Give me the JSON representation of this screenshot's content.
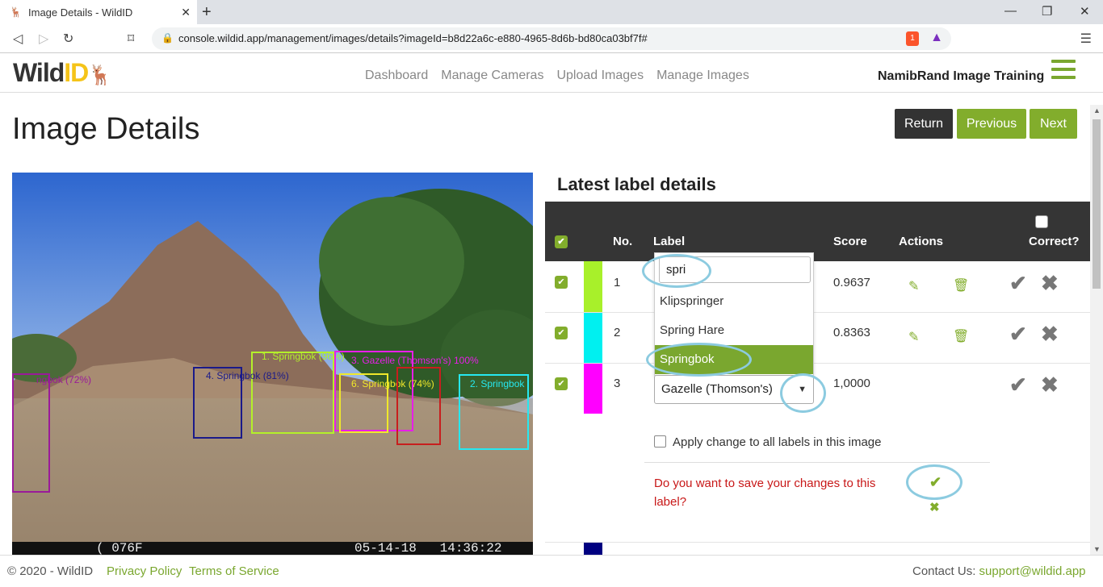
{
  "browser": {
    "tab_title": "Image Details - WildID",
    "url": "console.wildid.app/management/images/details?imageId=b8d22a6c-e880-4965-8d6b-bd80ca03bf7f#",
    "brave_badge": "1"
  },
  "header": {
    "logo_wild": "Wild",
    "logo_id": "ID",
    "nav": [
      "Dashboard",
      "Manage Cameras",
      "Upload Images",
      "Manage Images"
    ],
    "org_name": "NamibRand Image Training"
  },
  "page": {
    "title": "Image Details",
    "return_label": "Return",
    "previous_label": "Previous",
    "next_label": "Next"
  },
  "photo": {
    "timestamp_left": "( 076F",
    "timestamp_right": "05-14-18   14:36:22",
    "boxes": [
      {
        "label": "1. Springbok (96%)",
        "color": "#b4f02a"
      },
      {
        "label": "2. Springbok",
        "color": "#26e8f0"
      },
      {
        "label": "3. Gazelle (Thomson's) 100%",
        "color": "#e81ee8"
      },
      {
        "label": "4. Springbok (81%)",
        "color": "#1a1a8a"
      },
      {
        "label": "6. Springbok (74%)",
        "color": "#f0e82a"
      },
      {
        "label": "ngbok (72%)",
        "color": "#9a1a9a"
      },
      {
        "label": "",
        "color": "#c81e1e"
      }
    ]
  },
  "labels": {
    "title": "Latest label details",
    "columns": {
      "no": "No.",
      "label": "Label",
      "score": "Score",
      "actions": "Actions",
      "correct": "Correct?"
    },
    "rows": [
      {
        "no": "1",
        "score": "0.9637",
        "color": "#a8f02a"
      },
      {
        "no": "2",
        "score": "0.8363",
        "color": "#00f0f0"
      },
      {
        "no": "3",
        "score": "1,0000",
        "color": "#ff00ff",
        "label": "Gazelle (Thomson's)"
      },
      {
        "no": "",
        "score": "",
        "color": "#000080"
      }
    ],
    "dropdown": {
      "search_value": "spri",
      "options": [
        "Klipspringer",
        "Spring Hare",
        "Springbok"
      ],
      "selected": "Springbok"
    },
    "apply_all": "Apply change to all labels in this image",
    "save_prompt": "Do you want to save your changes to this label?"
  },
  "footer": {
    "copyright": "© 2020 - WildID",
    "privacy": "Privacy Policy",
    "terms": "Terms of Service",
    "contact_prefix": "Contact Us:",
    "contact_email": "support@wildid.app"
  }
}
